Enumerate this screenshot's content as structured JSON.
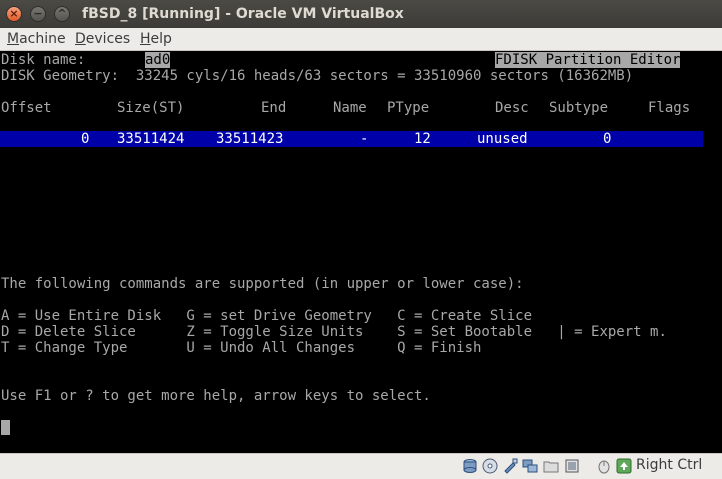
{
  "window": {
    "title": "fBSD_8 [Running] - Oracle VM VirtualBox",
    "close_glyph": "×",
    "min_glyph": "−",
    "max_glyph": "^"
  },
  "menu": {
    "machine": {
      "first": "M",
      "rest": "achine"
    },
    "devices": {
      "first": "D",
      "rest": "evices"
    },
    "help": {
      "first": "H",
      "rest": "elp"
    }
  },
  "console": {
    "disk_name_label": "Disk name:",
    "disk_name_value": "ad0",
    "editor_title": "FDISK Partition Editor",
    "geometry": "DISK Geometry:  33245 cyls/16 heads/63 sectors = 33510960 sectors (16362MB)",
    "headers": {
      "offset": "Offset",
      "size": "Size(ST)",
      "end": "End",
      "name": "Name",
      "ptype": "PType",
      "desc": "Desc",
      "subtype": "Subtype",
      "flags": "Flags"
    },
    "partition_row": {
      "offset": "0",
      "size": "33511424",
      "end": "33511423",
      "name": "-",
      "ptype": "12",
      "desc": "unused",
      "subtype": "0"
    },
    "commands_intro": "The following commands are supported (in upper or lower case):",
    "commands": [
      "A = Use Entire Disk   G = set Drive Geometry   C = Create Slice",
      "D = Delete Slice      Z = Toggle Size Units    S = Set Bootable   | = Expert m.",
      "T = Change Type       U = Undo All Changes     Q = Finish"
    ],
    "help_line": "Use F1 or ? to get more help, arrow keys to select."
  },
  "statusbar": {
    "host_key_label": "Right Ctrl",
    "icons": [
      "hard-disk-icon",
      "optical-disc-icon",
      "usb-icon",
      "network-icon",
      "shared-folder-icon",
      "display-icon",
      "mouse-integration-icon",
      "host-key-icon"
    ]
  },
  "colors": {
    "console_bg": "#000000",
    "console_fg": "#a8a8a8",
    "selection_bg": "#0000a8",
    "titlebar_bg": "#3c3b37"
  }
}
